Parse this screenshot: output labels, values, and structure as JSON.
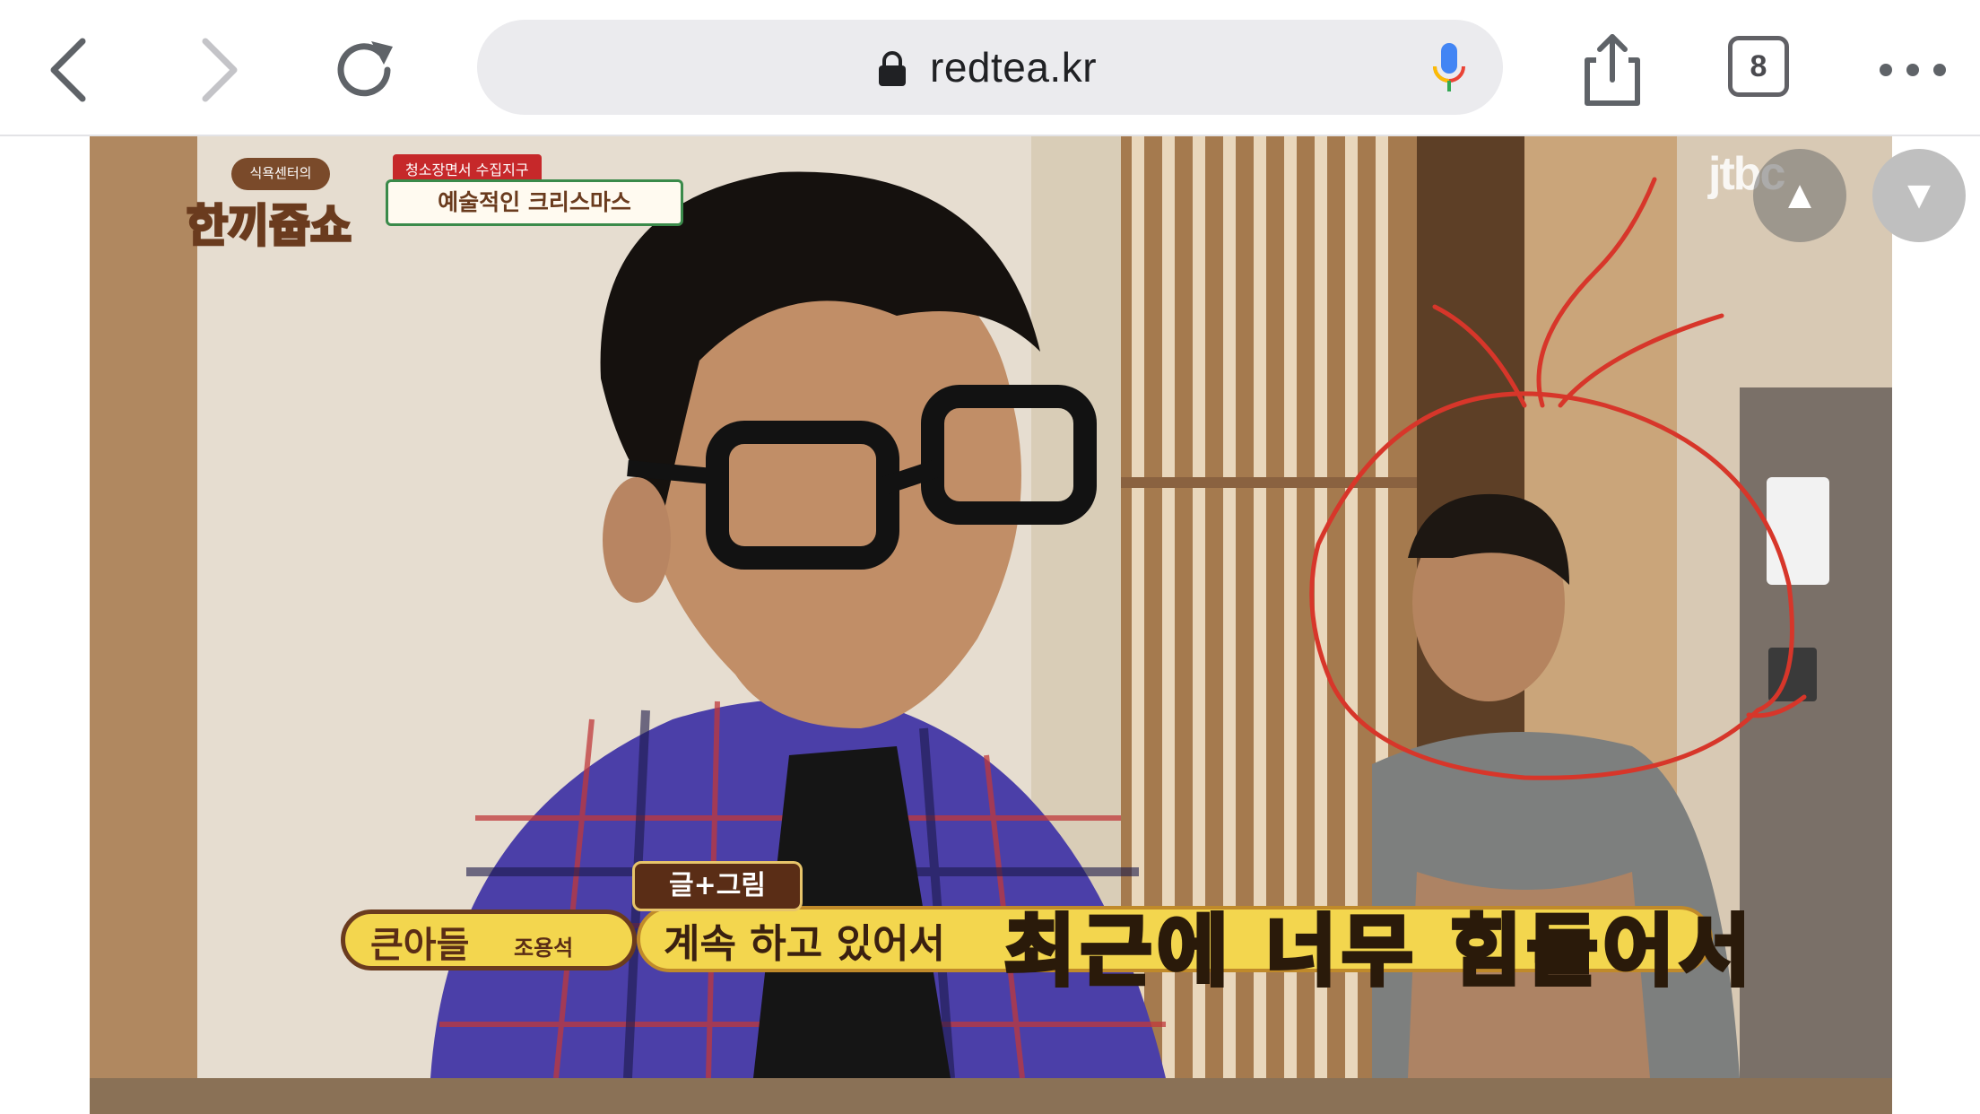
{
  "browser": {
    "url": "redtea.kr",
    "tab_count": "8",
    "icons": {
      "back": "chevron-left-icon",
      "forward": "chevron-right-icon",
      "reload": "reload-icon",
      "lock": "lock-icon",
      "mic": "microphone-icon",
      "share": "share-icon",
      "more": "more-dots-icon"
    }
  },
  "video": {
    "watermark": "jtbc",
    "show_logo_caption": "식욕센터의",
    "show_logo_title": "한끼줍쇼",
    "episode_top": "청소장면서 수집지구",
    "episode_title": "예술적인 크리스마스",
    "subtitle_tag": "글+그림",
    "speaker_name": "큰아들",
    "speaker_person": "조용석",
    "subtitle_line": "계속 하고 있어서",
    "subtitle_emphasis": "최근에 너무 힘들어서"
  },
  "page_controls": {
    "scroll_up_label": "▲",
    "scroll_down_label": "▼"
  },
  "colors": {
    "annotation": "#d7362a",
    "toolbar_bg": "#ffffff",
    "omnibox_bg": "#ebebee"
  }
}
